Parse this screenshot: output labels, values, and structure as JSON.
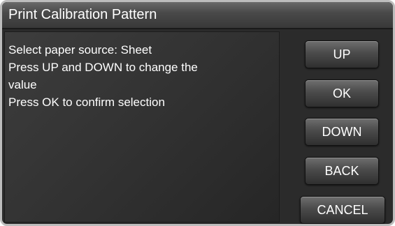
{
  "title": "Print Calibration Pattern",
  "message": {
    "lines": [
      "Select paper source: Sheet",
      "Press UP and DOWN to change the",
      "value",
      "Press OK to confirm selection"
    ]
  },
  "buttons": {
    "up": "UP",
    "ok": "OK",
    "down": "DOWN",
    "back": "BACK",
    "cancel": "CANCEL"
  }
}
